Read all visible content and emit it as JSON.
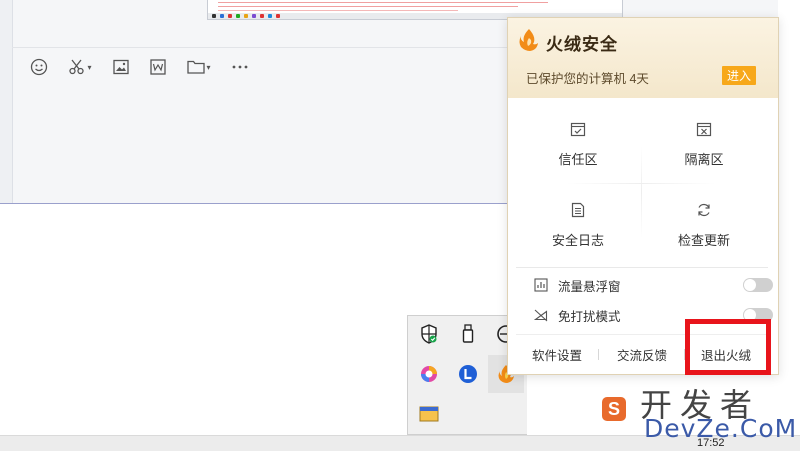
{
  "popup": {
    "title": "火绒安全",
    "status_text": "已保护您的计算机 4天",
    "enter_label": "进入",
    "features": [
      {
        "label": "信任区",
        "icon": "trust-zone-icon"
      },
      {
        "label": "隔离区",
        "icon": "quarantine-icon"
      },
      {
        "label": "安全日志",
        "icon": "security-log-icon"
      },
      {
        "label": "检查更新",
        "icon": "refresh-icon"
      }
    ],
    "toggles": [
      {
        "label": "流量悬浮窗",
        "on": false,
        "icon": "traffic-chart-icon"
      },
      {
        "label": "免打扰模式",
        "on": false,
        "icon": "do-not-disturb-icon"
      }
    ],
    "footer": {
      "settings_label": "软件设置",
      "feedback_label": "交流反馈",
      "exit_label": "退出火绒"
    }
  },
  "chat_toolbar": {
    "icons": [
      "emoji-icon",
      "scissors-icon",
      "image-icon",
      "word-doc-icon",
      "folder-icon",
      "more-icon"
    ]
  },
  "tray_icons": [
    "defender-shield-icon",
    "usb-drive-icon",
    "network-icon",
    "app-swirl-icon",
    "l-app-icon",
    "huorong-tray-icon",
    "window-app-icon"
  ],
  "taskbar": {
    "clock": "17:52"
  },
  "watermark": {
    "brand_cn": "开发者",
    "brand_en": "DevZe.CoM"
  },
  "colors": {
    "accent": "#f7a81b",
    "highlight": "#e8141b",
    "brand_orange": "#f28c18"
  }
}
